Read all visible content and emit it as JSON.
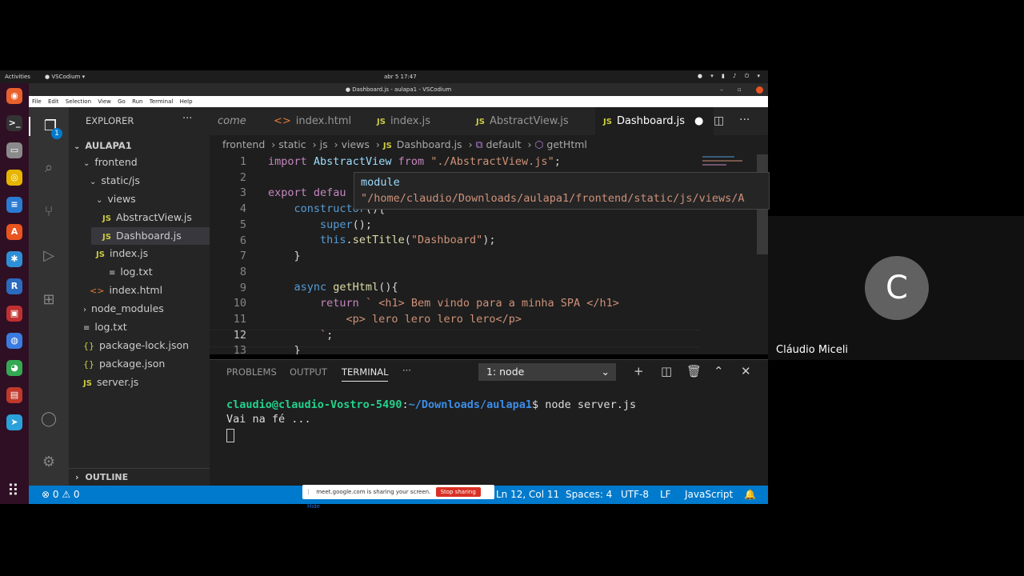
{
  "topbar": {
    "activities": "Activities",
    "app": "● VSCodium ▾",
    "clock": "abr 5  17:47",
    "tray": "● ▾ ▮ ♪ ⏻ ▾"
  },
  "window": {
    "title": "● Dashboard.js - aulapa1 - VSCodium",
    "controls": "– ▫"
  },
  "menu": [
    "File",
    "Edit",
    "Selection",
    "View",
    "Go",
    "Run",
    "Terminal",
    "Help"
  ],
  "dock": {
    "items": [
      {
        "icon": "firefox-icon",
        "glyph": "◉",
        "color": "#e8602c"
      },
      {
        "icon": "terminal-icon",
        "glyph": ">_",
        "color": "#333333"
      },
      {
        "icon": "files-icon",
        "glyph": "▭",
        "color": "#8a8a8a"
      },
      {
        "icon": "rhythmbox-icon",
        "glyph": "◎",
        "color": "#e6b500"
      },
      {
        "icon": "writer-icon",
        "glyph": "≡",
        "color": "#2a7bd1"
      },
      {
        "icon": "software-icon",
        "glyph": "A",
        "color": "#e9541f"
      },
      {
        "icon": "vscodium-icon",
        "glyph": "✱",
        "color": "#2f8fd6"
      },
      {
        "icon": "r-icon",
        "glyph": "R",
        "color": "#2b6bbf"
      },
      {
        "icon": "image-viewer-icon",
        "glyph": "▣",
        "color": "#c03030"
      },
      {
        "icon": "chat-icon",
        "glyph": "◍",
        "color": "#3a7be0"
      },
      {
        "icon": "chrome-icon",
        "glyph": "◕",
        "color": "#34a853"
      },
      {
        "icon": "calendar-icon",
        "glyph": "▤",
        "color": "#c0392b"
      },
      {
        "icon": "telegram-icon",
        "glyph": "➤",
        "color": "#2aa1da"
      }
    ],
    "apps_glyph": "⠿"
  },
  "activity": {
    "badge": "1"
  },
  "explorer": {
    "title": "EXPLORER",
    "more": "···",
    "project": "AULAPA1",
    "items": [
      {
        "label": "frontend",
        "kind": "folder-open"
      },
      {
        "label": "static/js",
        "kind": "folder-open"
      },
      {
        "label": "views",
        "kind": "folder-open"
      },
      {
        "label": "AbstractView.js",
        "kind": "js"
      },
      {
        "label": "Dashboard.js",
        "kind": "js"
      },
      {
        "label": "index.js",
        "kind": "js"
      },
      {
        "label": "log.txt",
        "kind": "txt"
      },
      {
        "label": "index.html",
        "kind": "html"
      },
      {
        "label": "node_modules",
        "kind": "folder"
      },
      {
        "label": "log.txt",
        "kind": "txt"
      },
      {
        "label": "package-lock.json",
        "kind": "json"
      },
      {
        "label": "package.json",
        "kind": "json"
      },
      {
        "label": "server.js",
        "kind": "js"
      }
    ],
    "outline": "OUTLINE"
  },
  "tabs": [
    {
      "label": "come",
      "icon": ""
    },
    {
      "label": "index.html",
      "icon": "<>"
    },
    {
      "label": "index.js",
      "icon": "JS"
    },
    {
      "label": "AbstractView.js",
      "icon": "JS"
    },
    {
      "label": "Dashboard.js",
      "icon": "JS"
    }
  ],
  "breadcrumb": [
    "frontend",
    "static",
    "js",
    "views",
    "Dashboard.js",
    "default",
    "getHtml"
  ],
  "editor": {
    "line_numbers": [
      "1",
      "2",
      "3",
      "4",
      "5",
      "6",
      "7",
      "8",
      "9",
      "10",
      "11",
      "12",
      "13"
    ],
    "current_line": "12",
    "hover": {
      "title": "module",
      "path": "\"/home/claudio/Downloads/aulapa1/frontend/static/js/views/A"
    }
  },
  "panel": {
    "tabs": [
      "PROBLEMS",
      "OUTPUT",
      "TERMINAL",
      "···"
    ],
    "active_tab": "TERMINAL",
    "terminal_select": "1: node",
    "terminal": {
      "user": "claudio@claudio-Vostro-5490",
      "path": "~/Downloads/aulapa1",
      "command": "$ node server.js",
      "output": "Vai na fé ..."
    }
  },
  "status": {
    "problems": "⊗ 0 ⚠ 0",
    "position": "Ln 12, Col 11",
    "spaces": "Spaces: 4",
    "encoding": "UTF-8",
    "eol": "LF",
    "language": "JavaScript"
  },
  "meet": {
    "sharing_text": "meet.google.com is sharing your screen.",
    "stop": "Stop sharing",
    "hide": "Hide"
  },
  "participant": {
    "initial": "C",
    "name": "Cláudio Miceli"
  }
}
